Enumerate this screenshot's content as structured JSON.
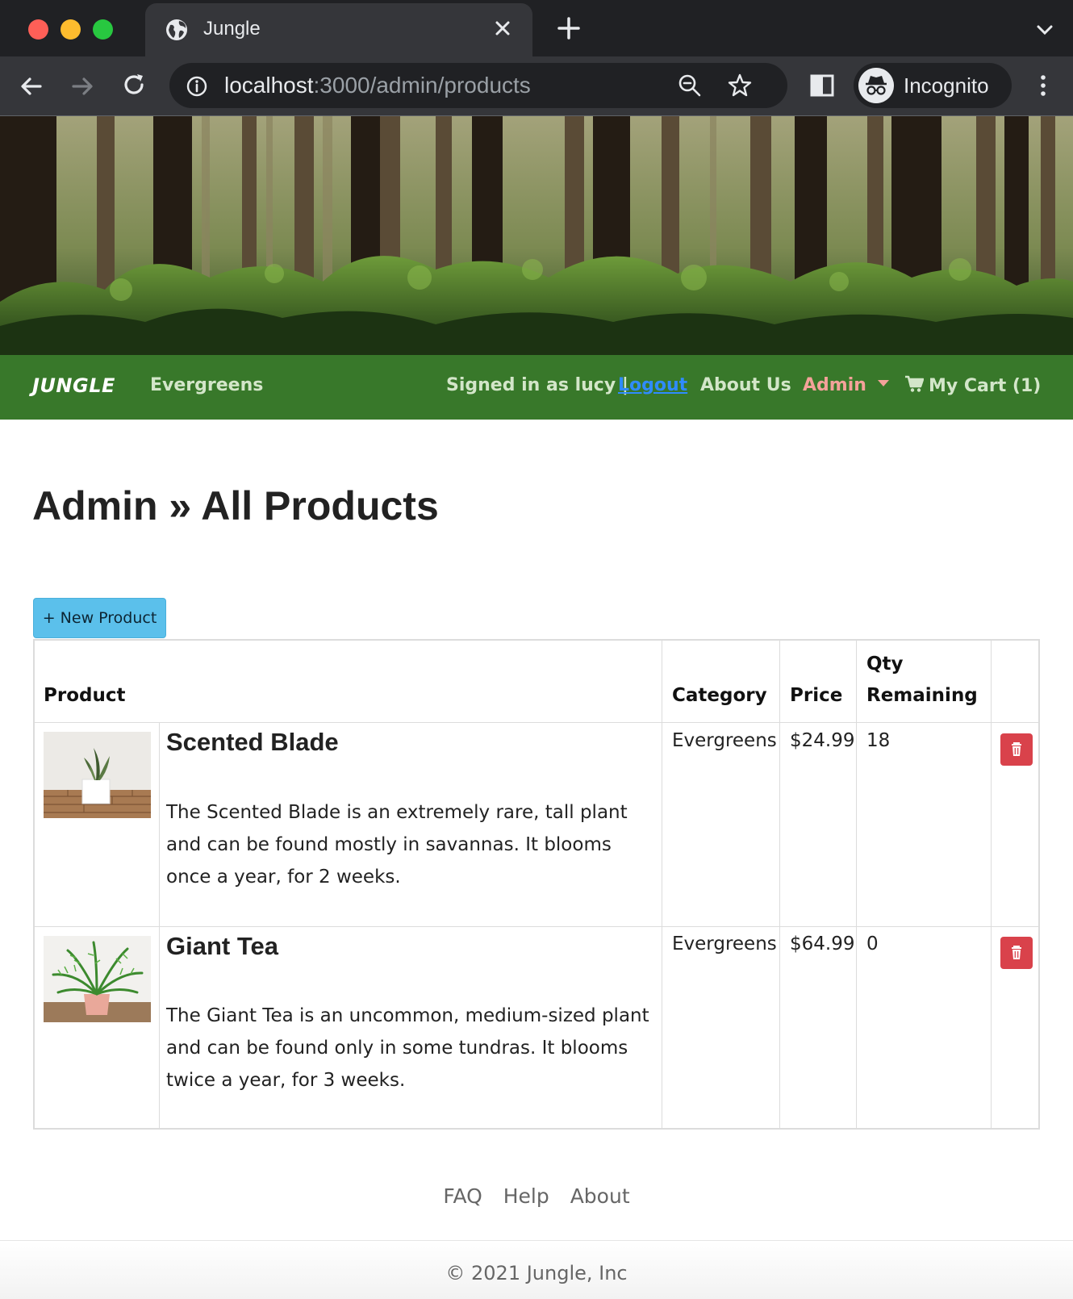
{
  "browser": {
    "tab_title": "Jungle",
    "url_host": "localhost",
    "url_path": ":3000/admin/products",
    "profile_label": "Incognito"
  },
  "nav": {
    "brand": "JUNGLE",
    "category": "Evergreens",
    "signed_in": "Signed in as lucy |",
    "logout": "Logout",
    "about": "About Us",
    "admin": "Admin",
    "cart": "My Cart (1)"
  },
  "page": {
    "title": "Admin » All Products",
    "new_button": "+ New Product"
  },
  "table": {
    "headers": {
      "product": "Product",
      "category": "Category",
      "price": "Price",
      "qty_line1": "Qty",
      "qty_line2": "Remaining"
    },
    "rows": [
      {
        "name": "Scented Blade",
        "description": "The Scented Blade is an extremely rare, tall plant and can be found mostly in savannas. It blooms once a year, for 2 weeks.",
        "category": "Evergreens",
        "price": "$24.99",
        "qty": "18",
        "image_icon": "snake-plant-image"
      },
      {
        "name": "Giant Tea",
        "description": "The Giant Tea is an uncommon, medium-sized plant and can be found only in some tundras. It blooms twice a year, for 3 weeks.",
        "category": "Evergreens",
        "price": "$64.99",
        "qty": "0",
        "image_icon": "fern-plant-image"
      }
    ]
  },
  "footer": {
    "links": [
      "FAQ",
      "Help",
      "About"
    ],
    "copyright": "© 2021 Jungle, Inc"
  },
  "colors": {
    "navbar": "#38782a",
    "new_button": "#5bc0eb",
    "delete_button": "#d9424b"
  }
}
